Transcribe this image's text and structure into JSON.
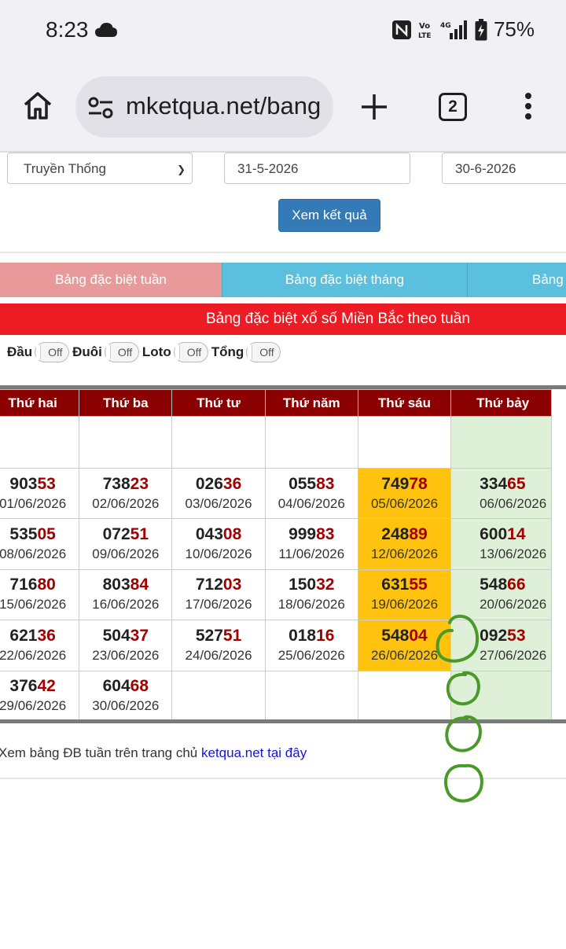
{
  "status_bar": {
    "time": "8:23",
    "battery": "75%",
    "icons": [
      "cloud-icon",
      "nfc-icon",
      "volte-icon",
      "4g-signal-icon",
      "battery-charging-icon"
    ]
  },
  "browser": {
    "url": "mketqua.net/bang",
    "tab_count": "2"
  },
  "form": {
    "region_select": "Truyền Thống",
    "date_from": "31-5-2026",
    "date_to": "30-6-2026",
    "submit_label": "Xem kết quả"
  },
  "tabs": [
    {
      "label": "Bảng đặc biệt tuần",
      "active": true
    },
    {
      "label": "Bảng đặc biệt tháng"
    },
    {
      "label": "Bảng"
    }
  ],
  "banner": "Bảng đặc biệt xổ số Miền Bắc theo tuần",
  "toggles": [
    {
      "label": "Đầu",
      "state": "Off"
    },
    {
      "label": "Đuôi",
      "state": "Off"
    },
    {
      "label": "Loto",
      "state": "Off"
    },
    {
      "label": "Tổng",
      "state": "Off"
    }
  ],
  "table": {
    "headers": [
      "Thứ hai",
      "Thứ ba",
      "Thứ tư",
      "Thứ năm",
      "Thứ sáu",
      "Thứ bảy"
    ],
    "rows": [
      [
        {
          "head": "903",
          "tail": "53",
          "date": "01/06/2026"
        },
        {
          "head": "738",
          "tail": "23",
          "date": "02/06/2026"
        },
        {
          "head": "026",
          "tail": "36",
          "date": "03/06/2026"
        },
        {
          "head": "055",
          "tail": "83",
          "date": "04/06/2026"
        },
        {
          "head": "749",
          "tail": "78",
          "date": "05/06/2026"
        },
        {
          "head": "334",
          "tail": "65",
          "date": "06/06/2026"
        }
      ],
      [
        {
          "head": "535",
          "tail": "05",
          "date": "08/06/2026"
        },
        {
          "head": "072",
          "tail": "51",
          "date": "09/06/2026"
        },
        {
          "head": "043",
          "tail": "08",
          "date": "10/06/2026"
        },
        {
          "head": "999",
          "tail": "83",
          "date": "11/06/2026"
        },
        {
          "head": "248",
          "tail": "89",
          "date": "12/06/2026"
        },
        {
          "head": "600",
          "tail": "14",
          "date": "13/06/2026"
        }
      ],
      [
        {
          "head": "716",
          "tail": "80",
          "date": "15/06/2026"
        },
        {
          "head": "803",
          "tail": "84",
          "date": "16/06/2026"
        },
        {
          "head": "712",
          "tail": "03",
          "date": "17/06/2026"
        },
        {
          "head": "150",
          "tail": "32",
          "date": "18/06/2026"
        },
        {
          "head": "631",
          "tail": "55",
          "date": "19/06/2026"
        },
        {
          "head": "548",
          "tail": "66",
          "date": "20/06/2026"
        }
      ],
      [
        {
          "head": "621",
          "tail": "36",
          "date": "22/06/2026"
        },
        {
          "head": "504",
          "tail": "37",
          "date": "23/06/2026"
        },
        {
          "head": "527",
          "tail": "51",
          "date": "24/06/2026"
        },
        {
          "head": "018",
          "tail": "16",
          "date": "25/06/2026"
        },
        {
          "head": "548",
          "tail": "04",
          "date": "26/06/2026"
        },
        {
          "head": "092",
          "tail": "53",
          "date": "27/06/2026"
        }
      ],
      [
        {
          "head": "376",
          "tail": "42",
          "date": "29/06/2026"
        },
        {
          "head": "604",
          "tail": "68",
          "date": "30/06/2026"
        }
      ]
    ]
  },
  "footer": {
    "text": "Xem bảng ĐB tuần trên trang chủ ",
    "link": "ketqua.net tại đây"
  },
  "colors": {
    "header_bg": "#8b0000",
    "tail_digits": "#a30000",
    "highlight_friday": "#ffc20e",
    "saturday_bg": "#dff0d8",
    "banner_bg": "#ed1c24",
    "active_tab": "#e89a9a",
    "inactive_tab": "#5bc0de",
    "button": "#337ab7",
    "scribble": "#4a9a2a"
  }
}
